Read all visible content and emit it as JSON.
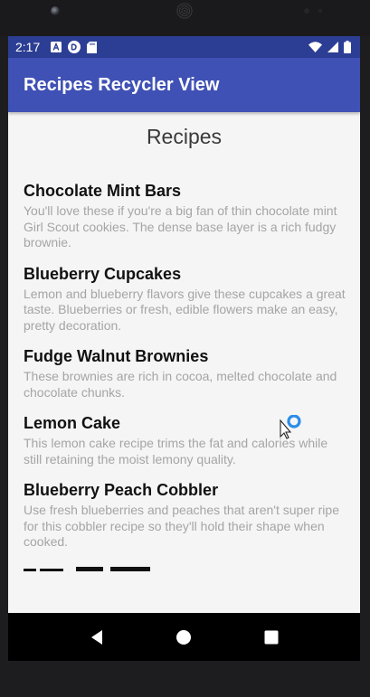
{
  "status_bar": {
    "time": "2:17",
    "icons_left": [
      "sim-a-icon",
      "media-icon",
      "sd-card-icon"
    ],
    "icons_right": [
      "wifi-icon",
      "cell-signal-icon",
      "battery-icon"
    ]
  },
  "app_bar": {
    "title": "Recipes Recycler View"
  },
  "list": {
    "heading": "Recipes",
    "items": [
      {
        "title": "Chocolate Mint Bars",
        "description": "You'll love these if you're a big fan of thin chocolate mint Girl Scout cookies. The dense base layer is a rich fudgy brownie."
      },
      {
        "title": "Blueberry Cupcakes",
        "description": "Lemon and blueberry flavors give these cupcakes a great taste. Blueberries or fresh, edible flowers make an easy, pretty decoration."
      },
      {
        "title": "Fudge Walnut Brownies",
        "description": "These brownies are rich in cocoa, melted chocolate and chocolate chunks."
      },
      {
        "title": "Lemon Cake",
        "description": "This lemon cake recipe trims the fat and calories while still retaining the moist lemony quality."
      },
      {
        "title": "Blueberry Peach Cobbler",
        "description": "Use fresh blueberries and peaches that aren't super ripe for this cobbler recipe so they'll hold their shape when cooked."
      }
    ]
  },
  "nav_bar": {
    "buttons": [
      "back-icon",
      "home-icon",
      "recents-icon"
    ]
  },
  "colors": {
    "primary": "#3f51b5",
    "primary_dark": "#2c3e94",
    "background": "#f5f5f5"
  }
}
